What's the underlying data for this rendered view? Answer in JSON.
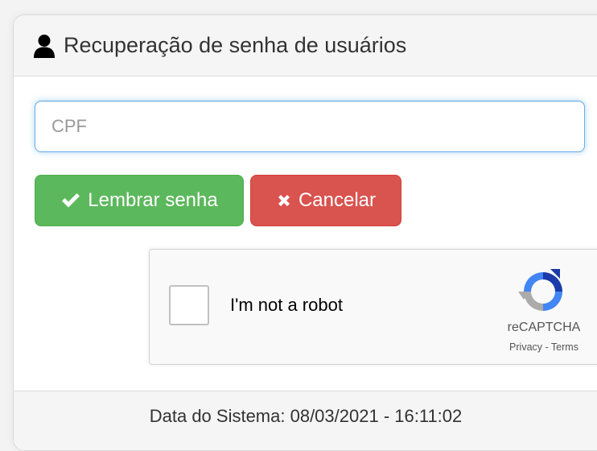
{
  "panel": {
    "title": "Recuperação de senha de usuários",
    "title_icon": "user-icon"
  },
  "form": {
    "cpf_placeholder": "CPF",
    "cpf_value": ""
  },
  "buttons": {
    "remember_label": "Lembrar senha",
    "remember_icon": "check-icon",
    "cancel_label": "Cancelar",
    "cancel_icon": "close-icon"
  },
  "recaptcha": {
    "checkbox_label": "I'm not a robot",
    "brand": "reCAPTCHA",
    "privacy": "Privacy",
    "separator": " - ",
    "terms": "Terms"
  },
  "footer": {
    "system_date": "Data do Sistema: 08/03/2021 - 16:11:02"
  },
  "colors": {
    "success": "#5cb85c",
    "danger": "#d9534f",
    "focus_border": "#66afe9"
  }
}
